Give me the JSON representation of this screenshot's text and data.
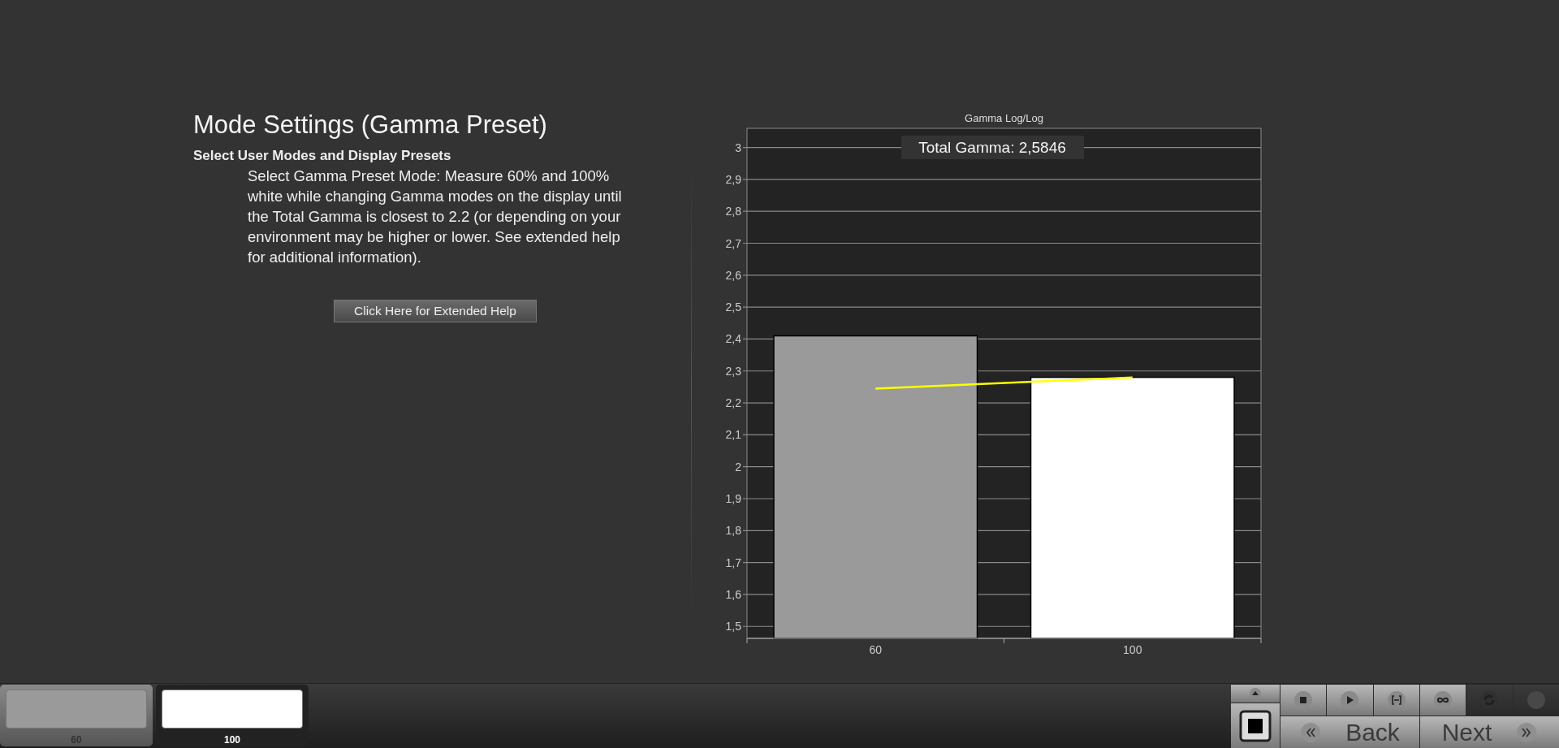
{
  "page": {
    "title": "Mode Settings (Gamma Preset)",
    "subtitle": "Select User Modes and Display Presets",
    "description": "Select Gamma Preset Mode: Measure 60% and 100% white while changing Gamma modes on the display until the Total Gamma is closest to 2.2 (or depending on your environment may be higher or lower. See extended help for additional information).",
    "help_button": "Click Here for Extended Help"
  },
  "chart": {
    "chart_data": {
      "type": "bar",
      "title": "Gamma Log/Log",
      "categories": [
        "60",
        "100"
      ],
      "series": [
        {
          "type": "bar",
          "colors": [
            "#9a9a9a",
            "#ffffff"
          ],
          "values": [
            2.41,
            2.28
          ]
        },
        {
          "type": "line",
          "color": "#ffff00",
          "values": [
            2.245,
            2.28
          ]
        }
      ],
      "ylim": [
        1.4625,
        3.06
      ],
      "grid": true,
      "yticks": [
        {
          "value": 1.5,
          "label": "1,5"
        },
        {
          "value": 1.6,
          "label": "1,6"
        },
        {
          "value": 1.7,
          "label": "1,7"
        },
        {
          "value": 1.8,
          "label": "1,8"
        },
        {
          "value": 1.9,
          "label": "1,9"
        },
        {
          "value": 2,
          "label": "2"
        },
        {
          "value": 2.1,
          "label": "2,1"
        },
        {
          "value": 2.2,
          "label": "2,2"
        },
        {
          "value": 2.3,
          "label": "2,3"
        },
        {
          "value": 2.4,
          "label": "2,4"
        },
        {
          "value": 2.5,
          "label": "2,5"
        },
        {
          "value": 2.6,
          "label": "2,6"
        },
        {
          "value": 2.7,
          "label": "2,7"
        },
        {
          "value": 2.8,
          "label": "2,8"
        },
        {
          "value": 2.9,
          "label": "2,9"
        },
        {
          "value": 3,
          "label": "3"
        }
      ],
      "annotations": [
        "Total Gamma: 2,5846"
      ]
    }
  },
  "patches": [
    {
      "label": "60",
      "color": "#9a9a9a",
      "selected": false
    },
    {
      "label": "100",
      "color": "#ffffff",
      "selected": true
    }
  ],
  "controls": {
    "toolbar": [
      {
        "kind": "stop",
        "disabled": false
      },
      {
        "kind": "play",
        "disabled": false
      },
      {
        "kind": "range",
        "disabled": false
      },
      {
        "kind": "loop",
        "disabled": false
      },
      {
        "kind": "refresh",
        "disabled": true
      },
      {
        "kind": "record",
        "disabled": true
      }
    ],
    "back": "Back",
    "next": "Next"
  }
}
